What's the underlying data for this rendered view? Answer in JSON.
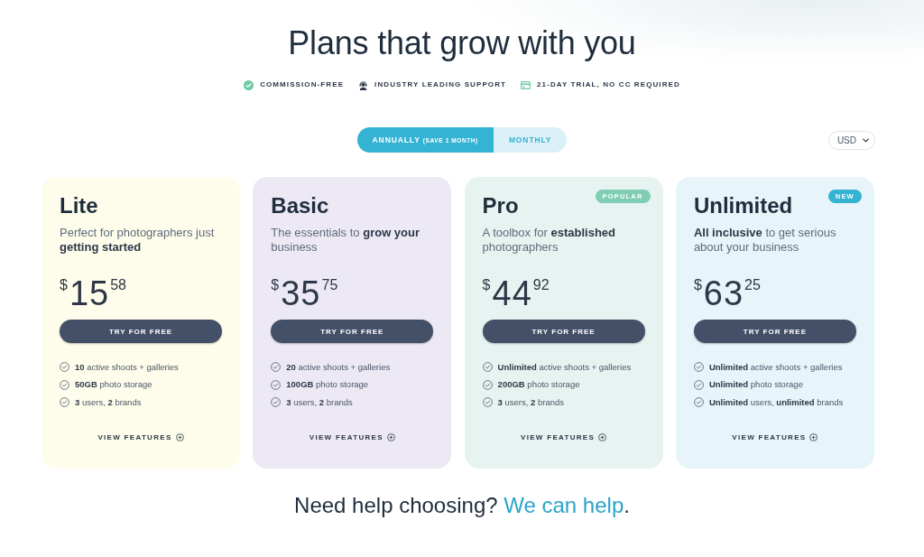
{
  "title": "Plans that grow with you",
  "highlights": [
    {
      "kind": "check",
      "label": "COMMISSION-FREE"
    },
    {
      "kind": "support",
      "label": "INDUSTRY LEADING SUPPORT"
    },
    {
      "kind": "card",
      "label": "21-DAY TRIAL, NO CC REQUIRED"
    }
  ],
  "billing_toggle": [
    {
      "label": "ANNUALLY",
      "note": "(SAVE 1 MONTH)",
      "selected": true
    },
    {
      "label": "MONTHLY",
      "selected": false
    }
  ],
  "currency_select": {
    "value": "USD"
  },
  "plans": [
    {
      "name": "Lite",
      "color": "#fefdeb",
      "description": "Perfect for photographers just **getting started**",
      "price": {
        "currency": "$",
        "whole": "15",
        "cents": "58"
      },
      "button": "TRY FOR FREE",
      "features": [
        "**10** active shoots + galleries",
        "**50GB** photo storage",
        "**3** users, **2** brands"
      ],
      "link": "VIEW FEATURES"
    },
    {
      "name": "Basic",
      "color": "#ece9f4",
      "description": "The essentials to **grow your** business",
      "price": {
        "currency": "$",
        "whole": "35",
        "cents": "75"
      },
      "button": "TRY FOR FREE",
      "features": [
        "**20** active shoots + galleries",
        "**100GB** photo storage",
        "**3** users, **2** brands"
      ],
      "link": "VIEW FEATURES"
    },
    {
      "name": "Pro",
      "color": "#e7f3f0",
      "badge": {
        "label": "POPULAR",
        "color": "#7ecdb4"
      },
      "description": "A toolbox for **established** photographers",
      "price": {
        "currency": "$",
        "whole": "44",
        "cents": "92"
      },
      "button": "TRY FOR FREE",
      "features": [
        "**Unlimited** active shoots + galleries",
        "**200GB** photo storage",
        "**3** users, **2** brands"
      ],
      "link": "VIEW FEATURES"
    },
    {
      "name": "Unlimited",
      "color": "#e7f4f9",
      "badge": {
        "label": "NEW",
        "color": "#35b3d3"
      },
      "description": "**All inclusive** to get serious about your business",
      "price": {
        "currency": "$",
        "whole": "63",
        "cents": "25"
      },
      "button": "TRY FOR FREE",
      "features": [
        "**Unlimited** active shoots + galleries",
        "**Unlimited** photo storage",
        "**Unlimited** users, **unlimited** brands"
      ],
      "link": "VIEW FEATURES"
    }
  ],
  "help": {
    "text": "Need help choosing?",
    "link": "We can help",
    "after": "."
  }
}
